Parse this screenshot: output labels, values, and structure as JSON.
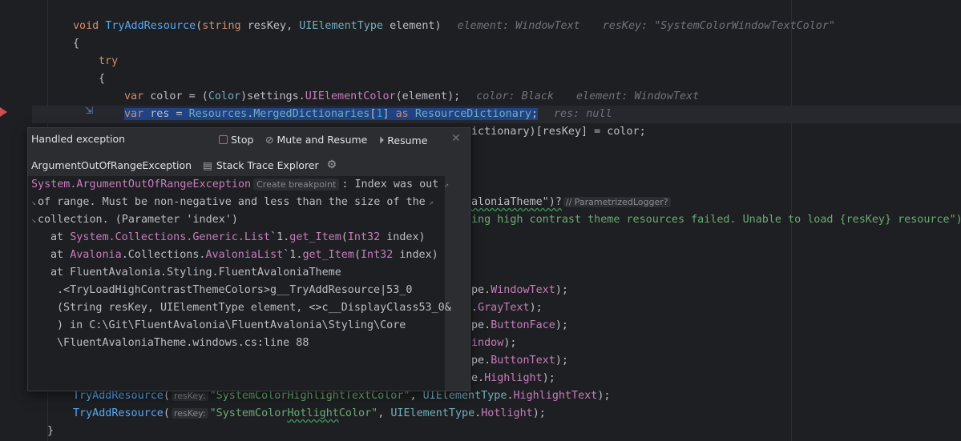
{
  "code": {
    "method_sig": {
      "void": "void",
      "name": "TryAddResource",
      "p1_type": "string",
      "p1_name": "resKey",
      "comma": ", ",
      "p2_type": "UIElementType",
      "p2_name": "element",
      "close": ")",
      "hint_element": "element: WindowText",
      "hint_reskey": "resKey: \"SystemColorWindowTextColor\""
    },
    "brace_open": "{",
    "try_kw": "try",
    "try_brace": "{",
    "line_color": {
      "var": "var",
      "name": "color",
      "eq": " = (",
      "cast": "Color",
      "mid": ")settings.",
      "method": "UIElementColor",
      "arg": "(element);",
      "hint_color": "color: Black",
      "hint_element": "element: WindowText"
    },
    "line_res": {
      "var": "var",
      "name": "res",
      "eq": " = ",
      "cls": "Resources",
      "dot": ".",
      "prop": "MergedDictionaries",
      "idx_open": "[",
      "idx": "1",
      "idx_close": "]",
      "as": "as",
      "type": "ResourceDictionary",
      "semi": ";",
      "hint_res": "res: null"
    },
    "line_dict_tail": "ictionary)[resKey] = color;",
    "line_logger": {
      "frag": "aloniaTheme\")?",
      "hint": "// ParametrizedLogger?"
    },
    "line_msg": "ing high contrast theme resources failed. Unable to load {resKey} resource\");",
    "tails": [
      {
        "pre": "pe.",
        "prop": "WindowText",
        "post": ");"
      },
      {
        "pre": ".",
        "prop": "GrayText",
        "post": ");"
      },
      {
        "pre": "pe.",
        "prop": "ButtonFace",
        "post": ");"
      },
      {
        "pre": "",
        "prop": "indow",
        "post": ");"
      },
      {
        "pre": "pe.",
        "prop": "ButtonText",
        "post": ");"
      },
      {
        "pre": "e.",
        "prop": "Highlight",
        "post": ");"
      }
    ],
    "add_hl_text": {
      "fn": "TryAddResource",
      "open": "(",
      "hint": "resKey:",
      "str": "\"SystemColorHighlightTextColor\"",
      "comma": ", ",
      "enum": "UIElementType",
      "dot": ".",
      "member": "HighlightText",
      "close": ");"
    },
    "add_hotlight": {
      "fn": "TryAddResource",
      "open": "(",
      "hint": "resKey:",
      "str_a": "\"SystemColor",
      "str_b": "Hotlight",
      "str_c": "Color\"",
      "comma": ", ",
      "enum": "UIElementType",
      "dot": ".",
      "member": "Hotlight",
      "close": ");"
    },
    "brace_close": "}"
  },
  "popup": {
    "title": "Handled exception",
    "stop_label": "Stop",
    "mute_label": "Mute and Resume",
    "resume_label": "Resume",
    "exception_name": "ArgumentOutOfRangeException",
    "stack_trace_label": "Stack Trace Explorer",
    "trace": {
      "exc_type": "System.ArgumentOutOfRangeException",
      "create_bp": "Create breakpoint",
      "msg1": ": Index was out",
      "msg2": "of range. Must be non-negative and less than the size of the",
      "msg3": "collection. (Parameter 'index')",
      "f1_at": "at ",
      "f1_ns": "System.Collections.Generic.",
      "f1_cls": "List",
      "f1_mid": "`1.",
      "f1_m": "get_Item",
      "f1_open": "(",
      "f1_t": "Int32",
      "f1_rest": " index)",
      "f2_at": "at ",
      "f2_ns": "Avalonia",
      "f2_ns2": ".Collections.",
      "f2_cls": "AvaloniaList",
      "f2_mid": "`1.",
      "f2_m": "get_Item",
      "f2_open": "(",
      "f2_t": "Int32",
      "f2_rest": " index)",
      "f3": "at FluentAvalonia.Styling.FluentAvaloniaTheme",
      "f4": ".<TryLoadHighContrastThemeColors>g__TryAddResource|53_0",
      "f5": "(String resKey, UIElementType element, <>c__DisplayClass53_0&",
      "f6": ") in C:\\Git\\FluentAvalonia\\FluentAvalonia\\Styling\\Core",
      "f7": "\\FluentAvaloniaTheme.windows.cs:line 88"
    }
  },
  "colors": {
    "accent": "#214283",
    "breakpoint": "#c94f4f",
    "stop": "#db5c5c"
  }
}
